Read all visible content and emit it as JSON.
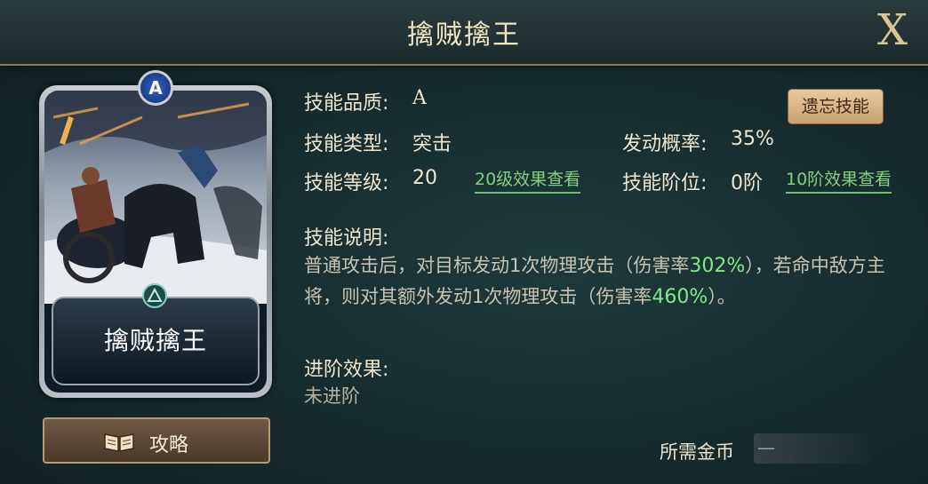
{
  "header": {
    "title": "擒贼擒王",
    "close_label": "X"
  },
  "card": {
    "name": "擒贼擒王",
    "quality_badge": "A",
    "accent_color": "#2f63c9"
  },
  "guide_button": {
    "label": "攻略",
    "icon": "book-icon"
  },
  "skill": {
    "quality_label": "技能品质:",
    "quality_value": "A",
    "type_label": "技能类型:",
    "type_value": "突击",
    "level_label": "技能等级:",
    "level_value": "20",
    "level_link": "20级效果查看",
    "chance_label": "发动概率:",
    "chance_value": "35%",
    "rank_label": "技能阶位:",
    "rank_value": "0阶",
    "rank_link": "10阶效果查看",
    "forget_button": "遗忘技能"
  },
  "description": {
    "label": "技能说明:",
    "part1": "普通攻击后，对目标发动1次物理攻击（伤害率",
    "rate1": "302%",
    "part2": "），若命中敌方主将，则对其额外发动1次物理攻击（伤害率",
    "rate2": "460%",
    "part3": "）。"
  },
  "advance": {
    "label": "进阶效果:",
    "value": "未进阶"
  },
  "cost": {
    "label": "所需金币",
    "value": "—"
  }
}
